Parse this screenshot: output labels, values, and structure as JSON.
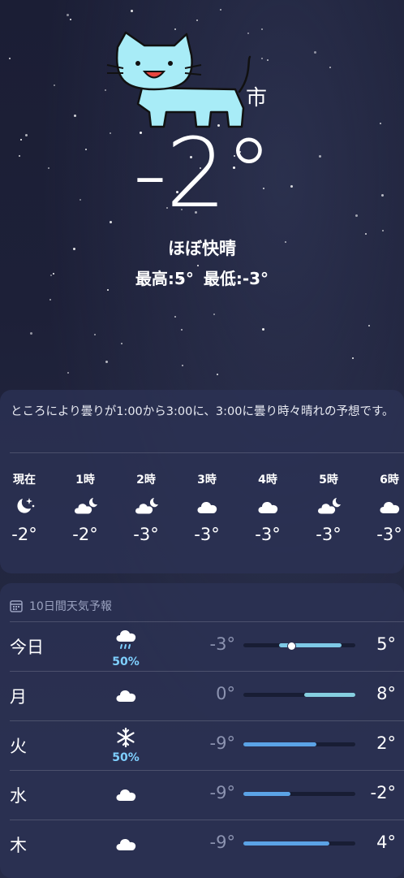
{
  "header": {
    "city_fragment": "市",
    "temperature": "-2°",
    "condition": "ほぼ快晴",
    "high": "最高:5°",
    "low": "最低:-3°"
  },
  "hourly": {
    "summary": "ところにより曇りが1:00から3:00に、3:00に曇り時々晴れの予想です。",
    "items": [
      {
        "time": "現在",
        "icon": "moon-stars-icon",
        "temp": "-2°"
      },
      {
        "time": "1時",
        "icon": "cloud-moon-icon",
        "temp": "-2°"
      },
      {
        "time": "2時",
        "icon": "cloud-moon-icon",
        "temp": "-3°"
      },
      {
        "time": "3時",
        "icon": "cloud-icon",
        "temp": "-3°"
      },
      {
        "time": "4時",
        "icon": "cloud-icon",
        "temp": "-3°"
      },
      {
        "time": "5時",
        "icon": "cloud-moon-icon",
        "temp": "-3°"
      },
      {
        "time": "6時",
        "icon": "cloud-icon",
        "temp": "-3°"
      }
    ]
  },
  "daily": {
    "title": "10日間天気予報",
    "title_icon": "calendar-icon",
    "days": [
      {
        "name": "今日",
        "icon": "cloud-rain-icon",
        "precip": "50%",
        "low": "-3°",
        "high": "5°",
        "range_start": 0.32,
        "range_end": 0.88,
        "current": 0.42,
        "fill_color": "#7ec9e6"
      },
      {
        "name": "月",
        "icon": "cloud-icon",
        "precip": "",
        "low": "0°",
        "high": "8°",
        "range_start": 0.54,
        "range_end": 1.0,
        "current": null,
        "fill_color": "#86cfe0"
      },
      {
        "name": "火",
        "icon": "snowflake-icon",
        "precip": "50%",
        "low": "-9°",
        "high": "2°",
        "range_start": 0.0,
        "range_end": 0.65,
        "current": null,
        "fill_color": "#5ba3e6"
      },
      {
        "name": "水",
        "icon": "cloud-icon",
        "precip": "",
        "low": "-9°",
        "high": "-2°",
        "range_start": 0.0,
        "range_end": 0.42,
        "current": null,
        "fill_color": "#5ba3e6"
      },
      {
        "name": "木",
        "icon": "cloud-icon",
        "precip": "",
        "low": "-9°",
        "high": "4°",
        "range_start": 0.0,
        "range_end": 0.77,
        "current": null,
        "fill_color": "#5ba3e6"
      }
    ]
  }
}
